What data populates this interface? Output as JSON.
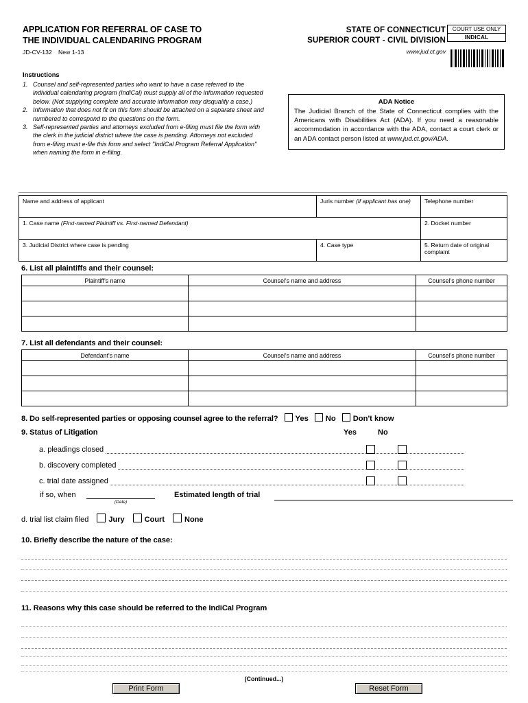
{
  "header": {
    "title_line1": "APPLICATION FOR REFERRAL OF CASE TO",
    "title_line2": "THE INDIVIDUAL CALENDARING PROGRAM",
    "form_number": "JD-CV-132",
    "form_revision": "New 1-13",
    "court_line1": "STATE OF CONNECTICUT",
    "court_line2": "SUPERIOR COURT - CIVIL DIVISION",
    "website": "www.jud.ct.gov",
    "court_use_only": "COURT USE ONLY",
    "court_use_code": "INDICAL"
  },
  "instructions": {
    "heading": "Instructions",
    "items": [
      {
        "num": "1.",
        "text": "Counsel and self-represented parties who want to have a case referred to the individual calendaring program (IndiCal) must supply all of the information requested below. (Not supplying complete and accurate information may disqualify a case.)"
      },
      {
        "num": "2.",
        "text": "Information that does not fit on this form should be attached on a separate sheet and numbered to correspond to the questions on the form."
      },
      {
        "num": "3.",
        "text": "Self-represented parties and attorneys excluded from e-filing must file the form with the clerk in the judicial district where the case is pending. Attorneys not excluded from e-filing must e-file this form and select \"IndiCal Program Referral Application\" when naming the form in e-filing."
      }
    ]
  },
  "ada_notice": {
    "title": "ADA Notice",
    "body": "The Judicial Branch of the State of Connecticut complies with the Americans with Disabilities Act (ADA). If you need a reasonable accommodation in accordance with the ADA, contact a court clerk or an ADA contact person listed at ",
    "url": "www.jud.ct.gov/ADA."
  },
  "applicant": {
    "name_address_label": "Name and address of applicant",
    "juris_label": "Juris number ",
    "juris_label_italic": "(if applicant has one)",
    "telephone_label": "Telephone number",
    "case_name_label": "1. Case name ",
    "case_name_label_italic": "(First-named Plaintiff vs. First-named Defendant)",
    "docket_label": "2. Docket number",
    "judicial_district_label": "3. Judicial District where case is pending",
    "case_type_label": "4. Case type",
    "return_date_label": "5. Return date of original complaint",
    "values": {
      "name_address": "",
      "juris_number": "",
      "telephone": "",
      "case_name": "",
      "docket_number": "",
      "judicial_district": "",
      "case_type": "",
      "return_date": ""
    }
  },
  "plaintiffs": {
    "heading": "6. List all plaintiffs and their counsel:",
    "columns": [
      "Plaintiff's name",
      "Counsel's name and address",
      "Counsel's phone number"
    ],
    "rows": [
      [
        "",
        "",
        ""
      ],
      [
        "",
        "",
        ""
      ],
      [
        "",
        "",
        ""
      ]
    ]
  },
  "defendants": {
    "heading": "7. List all defendants and their counsel:",
    "columns": [
      "Defendant's name",
      "Counsel's name and address",
      "Counsel's phone number"
    ],
    "rows": [
      [
        "",
        "",
        ""
      ],
      [
        "",
        "",
        ""
      ],
      [
        "",
        "",
        ""
      ]
    ]
  },
  "question8": {
    "text": "8. Do self-represented parties or opposing counsel agree to the referral?",
    "options": [
      "Yes",
      "No",
      "Don't know"
    ]
  },
  "question9": {
    "heading": "9. Status of Litigation",
    "yes_label": "Yes",
    "no_label": "No",
    "rows": [
      {
        "label": "a. pleadings closed"
      },
      {
        "label": "b. discovery completed"
      },
      {
        "label": "c. trial date assigned"
      }
    ],
    "if_so_when_label": "if so, when",
    "date_caption": "(Date)",
    "estimated_length_label": "Estimated length of trial",
    "trial_list_label": "d. trial list claim filed",
    "trial_list_options": [
      "Jury",
      "Court",
      "None"
    ],
    "values": {
      "trial_date": "",
      "estimated_length": ""
    }
  },
  "question10": {
    "heading": "10. Briefly describe the nature of the case:",
    "lines": 4,
    "value": ""
  },
  "question11": {
    "heading": "11. Reasons why this case should be referred to the IndiCal Program",
    "lines": 5,
    "value": ""
  },
  "footer": {
    "continued": "(Continued...)",
    "print_button": "Print Form",
    "reset_button": "Reset Form"
  }
}
